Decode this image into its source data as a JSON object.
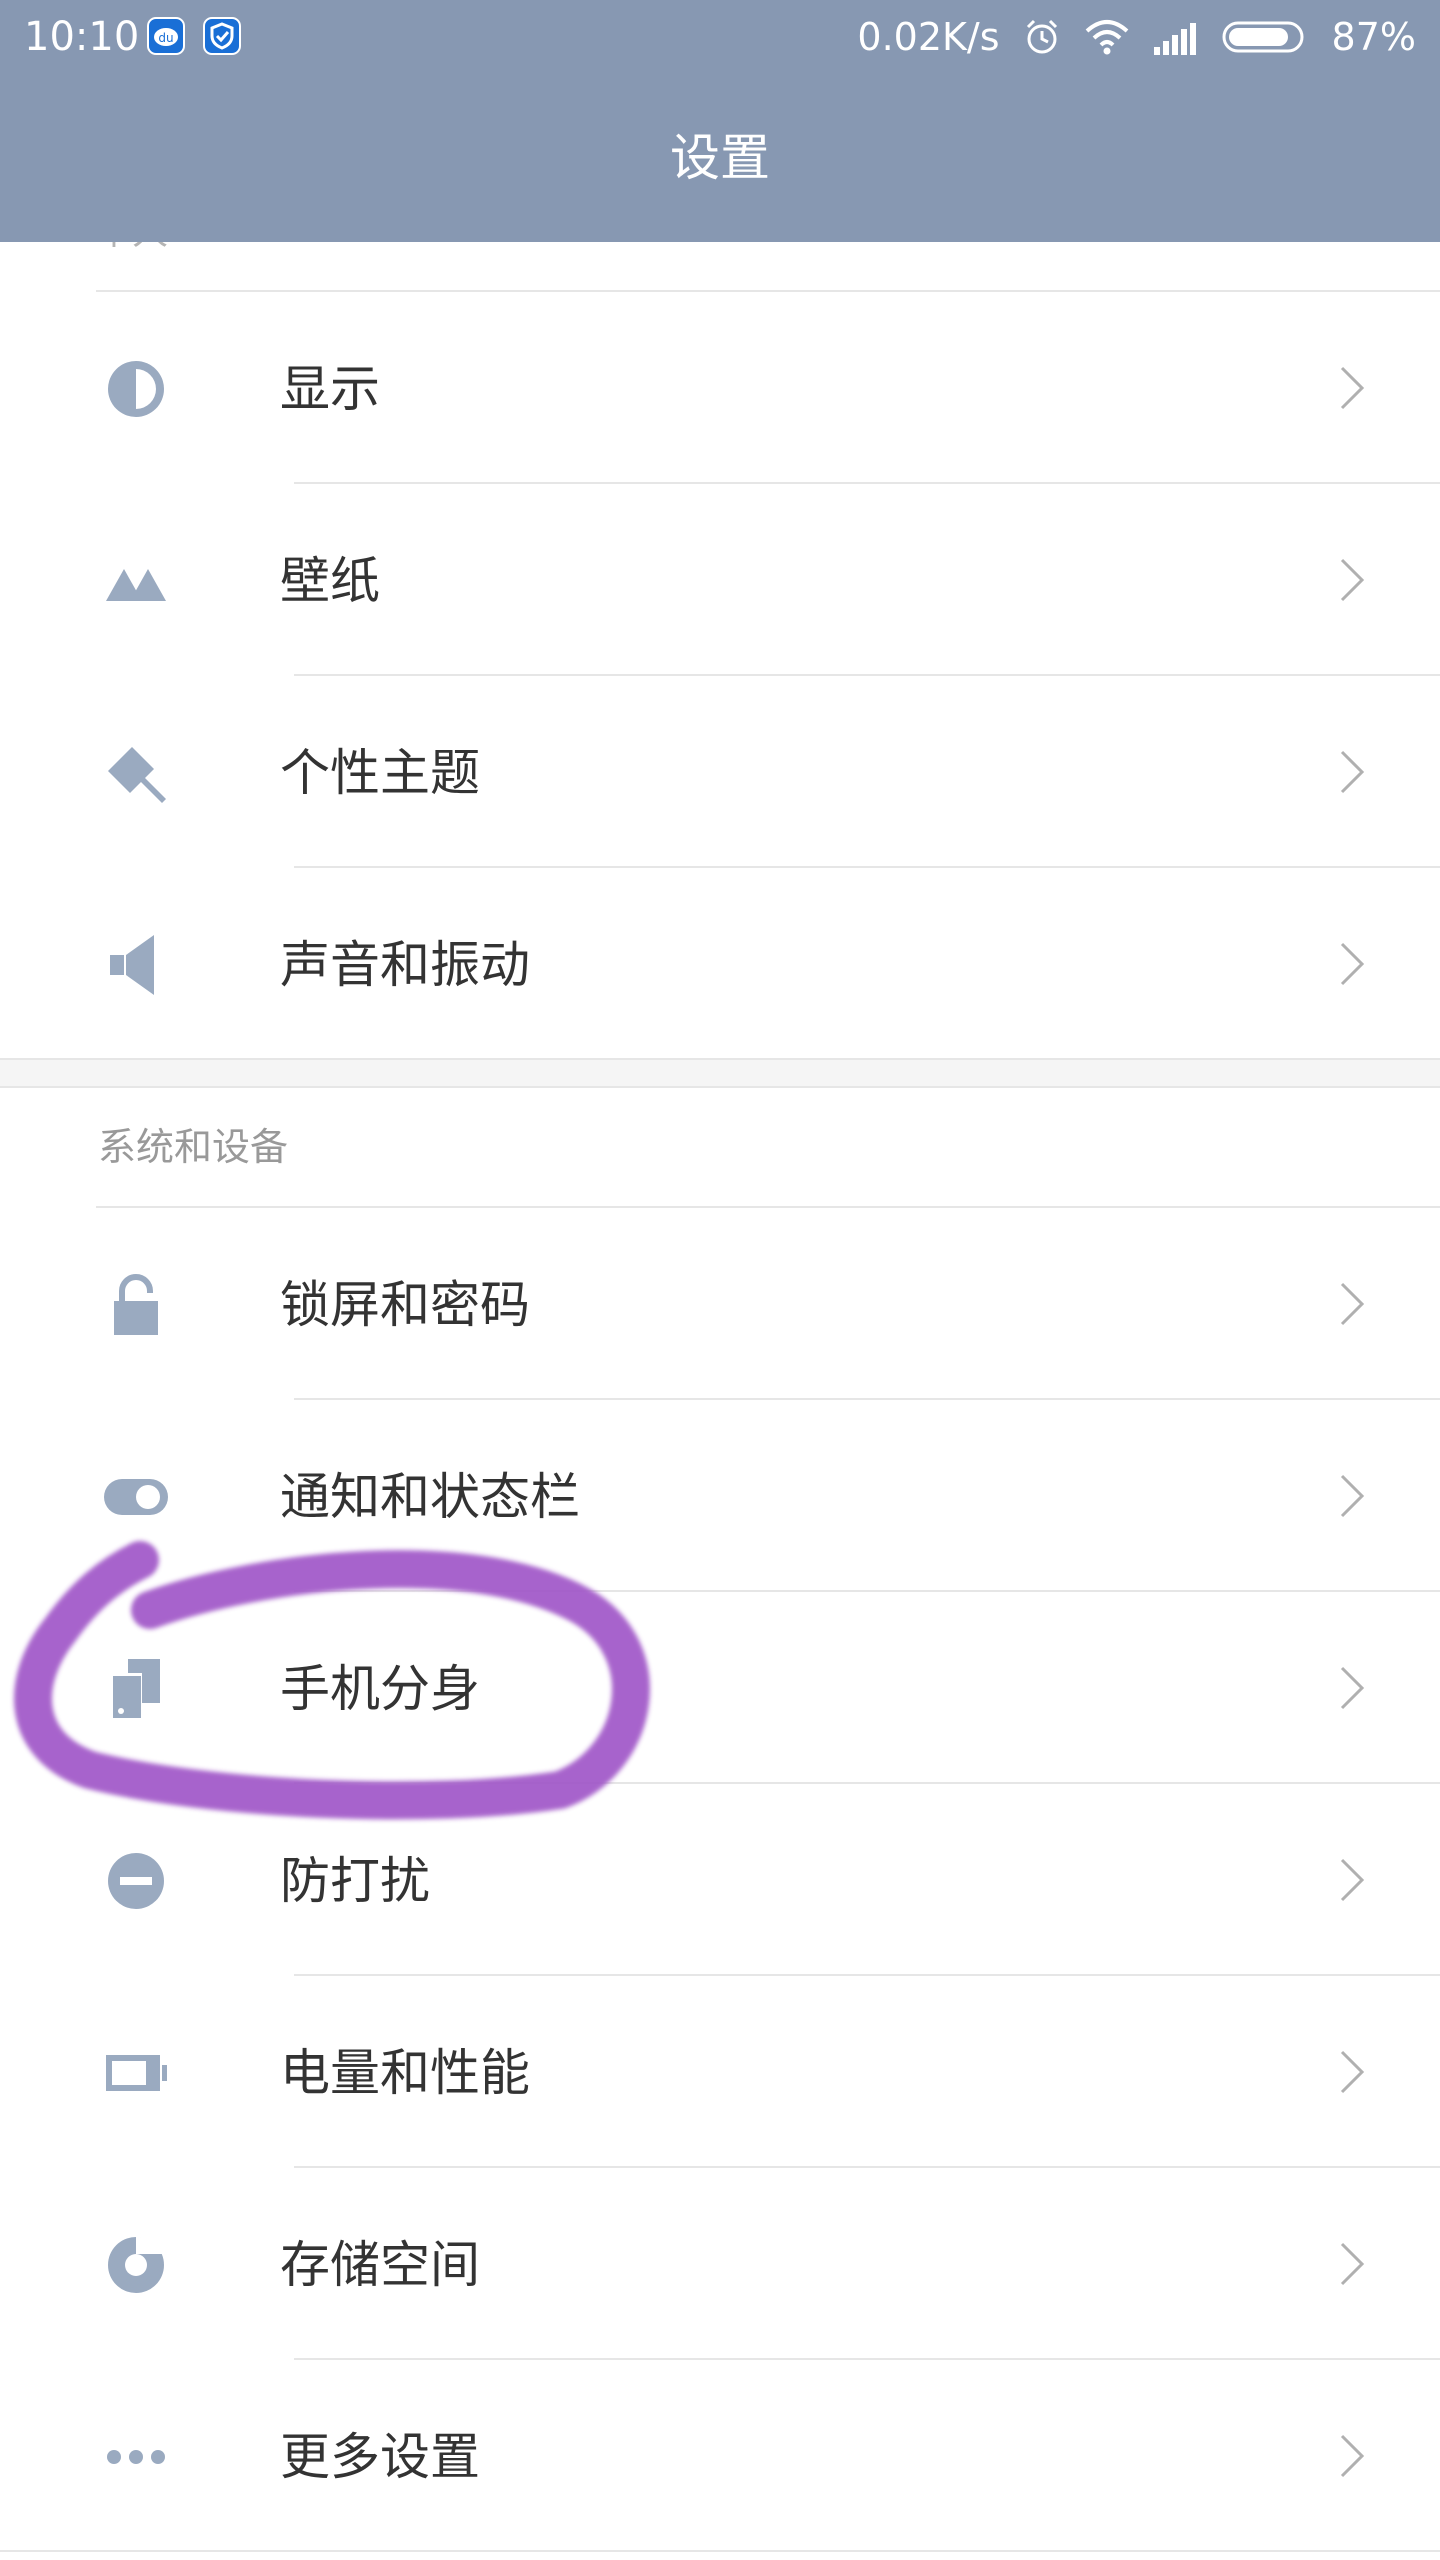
{
  "status_bar": {
    "time": "10:10",
    "network_speed": "0.02K/s",
    "battery": "87%",
    "battery_level": 0.87,
    "icons": [
      "du-app-icon",
      "shield-app-icon",
      "alarm-icon",
      "wifi-icon",
      "signal-icon",
      "battery-icon"
    ]
  },
  "header": {
    "title": "设置"
  },
  "sections": [
    {
      "title": "个人",
      "items": [
        {
          "label": "显示",
          "icon": "contrast-icon"
        },
        {
          "label": "壁纸",
          "icon": "mountain-icon"
        },
        {
          "label": "个性主题",
          "icon": "paint-brush-icon"
        },
        {
          "label": "声音和振动",
          "icon": "speaker-icon"
        }
      ]
    },
    {
      "title": "系统和设备",
      "items": [
        {
          "label": "锁屏和密码",
          "icon": "lock-icon"
        },
        {
          "label": "通知和状态栏",
          "icon": "toggle-icon"
        },
        {
          "label": "手机分身",
          "icon": "dual-phone-icon"
        },
        {
          "label": "防打扰",
          "icon": "do-not-disturb-icon"
        },
        {
          "label": "电量和性能",
          "icon": "battery-icon"
        },
        {
          "label": "存储空间",
          "icon": "pie-chart-icon"
        },
        {
          "label": "更多设置",
          "icon": "more-dots-icon"
        }
      ]
    }
  ],
  "colors": {
    "header_bg": "#8798b2",
    "icon": "#9aaac0",
    "highlight": "#a056c8"
  }
}
